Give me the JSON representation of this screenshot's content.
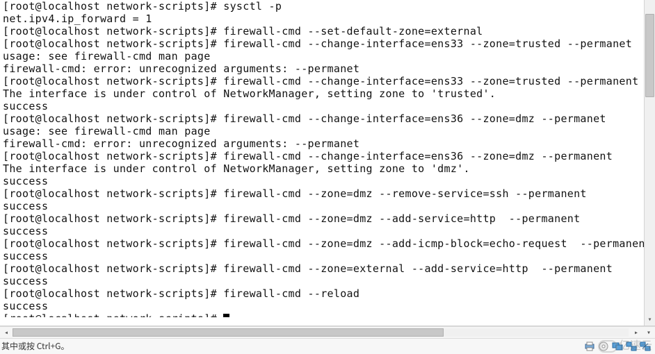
{
  "terminal": {
    "lines": [
      "[root@localhost network-scripts]# sysctl -p",
      "net.ipv4.ip_forward = 1",
      "[root@localhost network-scripts]# firewall-cmd --set-default-zone=external",
      "[root@localhost network-scripts]# firewall-cmd --change-interface=ens33 --zone=trusted --permanet",
      "usage: see firewall-cmd man page",
      "firewall-cmd: error: unrecognized arguments: --permanet",
      "[root@localhost network-scripts]# firewall-cmd --change-interface=ens33 --zone=trusted --permanent",
      "The interface is under control of NetworkManager, setting zone to 'trusted'.",
      "success",
      "[root@localhost network-scripts]# firewall-cmd --change-interface=ens36 --zone=dmz --permanet",
      "usage: see firewall-cmd man page",
      "firewall-cmd: error: unrecognized arguments: --permanet",
      "[root@localhost network-scripts]# firewall-cmd --change-interface=ens36 --zone=dmz --permanent",
      "The interface is under control of NetworkManager, setting zone to 'dmz'.",
      "success",
      "[root@localhost network-scripts]# firewall-cmd --zone=dmz --remove-service=ssh --permanent",
      "success",
      "[root@localhost network-scripts]# firewall-cmd --zone=dmz --add-service=http  --permanent",
      "success",
      "[root@localhost network-scripts]# firewall-cmd --zone=dmz --add-icmp-block=echo-request  --permanent",
      "success",
      "[root@localhost network-scripts]# firewall-cmd --zone=external --add-service=http  --permanent",
      "success",
      "[root@localhost network-scripts]# firewall-cmd --reload",
      "success"
    ],
    "prompt_line": "[root@localhost network-scripts]# "
  },
  "status": {
    "hint": "其中或按 Ctrl+G。"
  },
  "watermark": {
    "text": "亿速云"
  },
  "icons": {
    "printer": "printer-icon",
    "cd": "cd-icon",
    "screens": "screens-icon",
    "network1": "network-icon",
    "network2": "network-icon-2"
  }
}
